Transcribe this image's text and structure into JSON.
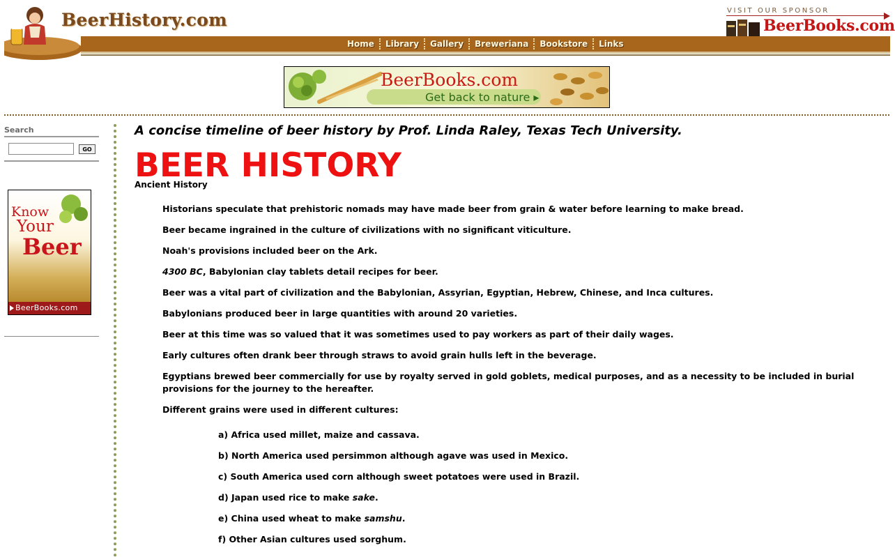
{
  "header": {
    "logo_text": "BeerHistory.com",
    "nav": [
      "Home",
      "Library",
      "Gallery",
      "Breweriana",
      "Bookstore",
      "Links"
    ],
    "sponsor_caption": "VISIT OUR SPONSOR",
    "sponsor_name": "BeerBooks.com"
  },
  "banner": {
    "title": "BeerBooks.com",
    "tagline": "Get back to nature ▸"
  },
  "sidebar": {
    "search_label": "Search",
    "search_value": "",
    "go_label": "GO",
    "ad": {
      "line1": "Know",
      "line2": "Your",
      "line3": "Beer",
      "footer": "BeerBooks.com"
    }
  },
  "content": {
    "subtitle": "A concise timeline of beer history by Prof. Linda Raley, Texas Tech University.",
    "title": "BEER HISTORY",
    "section": "Ancient History",
    "paragraphs": [
      "Historians speculate that prehistoric nomads may have made beer from grain & water before learning to make bread.",
      "Beer became ingrained in the culture of civilizations with no significant viticulture.",
      "Noah's provisions included beer on the Ark.",
      {
        "em": "4300 BC",
        "text": ", Babylonian clay tablets detail recipes for beer."
      },
      "Beer was a vital part of civilization and the Babylonian, Assyrian, Egyptian, Hebrew, Chinese, and Inca cultures.",
      "Babylonians produced beer in large quantities with around 20 varieties.",
      "Beer at this time was so valued that it was sometimes used to pay workers as part of their daily wages.",
      "Early cultures often drank beer through straws to avoid grain hulls left in the beverage.",
      "Egyptians brewed beer commercially for use by royalty served in gold goblets, medical purposes, and as a necessity to be included in burial provisions for the journey to the hereafter.",
      "Different grains were used in different cultures:"
    ],
    "grains": [
      {
        "text": "a) Africa used millet, maize and cassava."
      },
      {
        "text": "b) North America used persimmon although agave was used in Mexico."
      },
      {
        "text": "c) South America used corn although sweet potatoes were used in Brazil."
      },
      {
        "text": "d) Japan used rice to make ",
        "em": "sake",
        "after": "."
      },
      {
        "text": "e) China used wheat to make ",
        "em": "samshu",
        "after": "."
      },
      {
        "text": "f) Other Asian cultures used sorghum."
      }
    ]
  }
}
